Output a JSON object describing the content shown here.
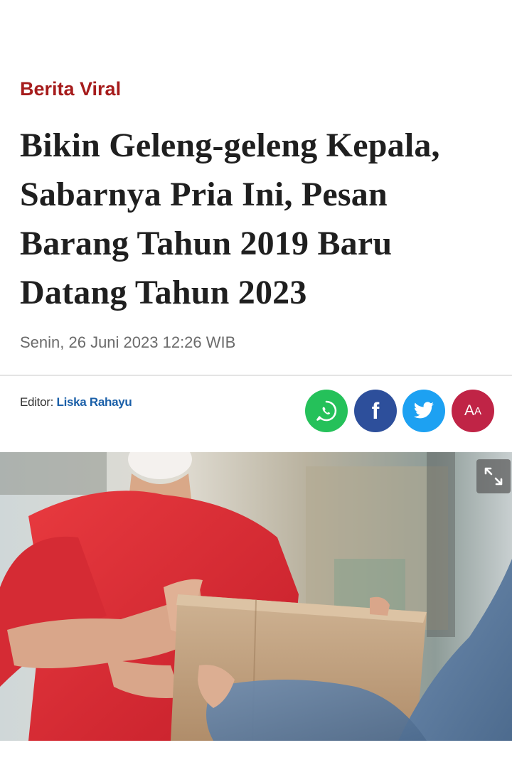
{
  "article": {
    "category": "Berita Viral",
    "title_lines": [
      "Bikin Geleng-geleng Kepala,",
      "Sabarnya Pria Ini, Pesan",
      "Barang Tahun 2019 Baru",
      "Datang Tahun 2023"
    ],
    "date": "Senin, 26 Juni 2023 12:26 WIB",
    "editor_label": "Editor:",
    "editor_name": "Liska Rahayu"
  },
  "share": {
    "whatsapp_icon": "whatsapp-icon",
    "facebook_label": "f",
    "twitter_icon": "twitter-icon",
    "font_size_label_big": "A",
    "font_size_label_small": "A"
  },
  "colors": {
    "category": "#a61c1c",
    "editor_name": "#1a5fa8",
    "whatsapp": "#25c15a",
    "facebook": "#2d4f9b",
    "twitter": "#1da1f2",
    "font_size": "#c02446"
  },
  "photo": {
    "expand_icon": "expand-icon"
  }
}
